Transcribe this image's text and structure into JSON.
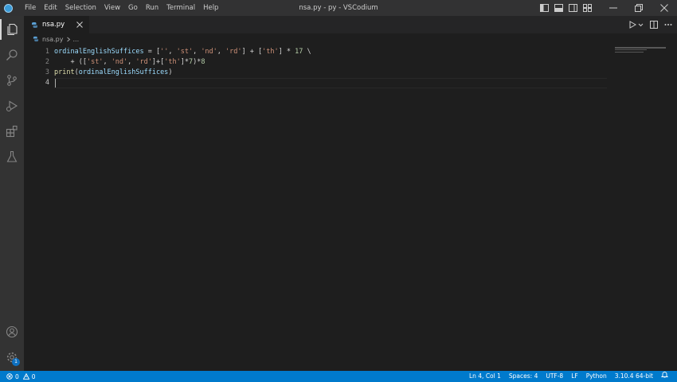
{
  "titlebar": {
    "window_title": "nsa.py - py - VSCodium",
    "menu": [
      "File",
      "Edit",
      "Selection",
      "View",
      "Go",
      "Run",
      "Terminal",
      "Help"
    ]
  },
  "tab": {
    "label": "nsa.py"
  },
  "breadcrumb": {
    "file": "nsa.py",
    "more": "..."
  },
  "editor": {
    "line_numbers": [
      "1",
      "2",
      "3",
      "4"
    ],
    "current_line": 4
  },
  "statusbar": {
    "errors": "0",
    "warnings": "0",
    "position": "Ln 4, Col 1",
    "spaces": "Spaces: 4",
    "encoding": "UTF-8",
    "eol": "LF",
    "language": "Python",
    "interpreter": "3.10.4 64-bit"
  },
  "activitybar": {
    "settings_badge": "1"
  },
  "colors": {
    "accent": "#007acc",
    "editor_bg": "#1e1e1e",
    "string": "#ce9178",
    "number": "#b5cea8",
    "function": "#dcdcaa",
    "variable": "#9cdcfe"
  }
}
